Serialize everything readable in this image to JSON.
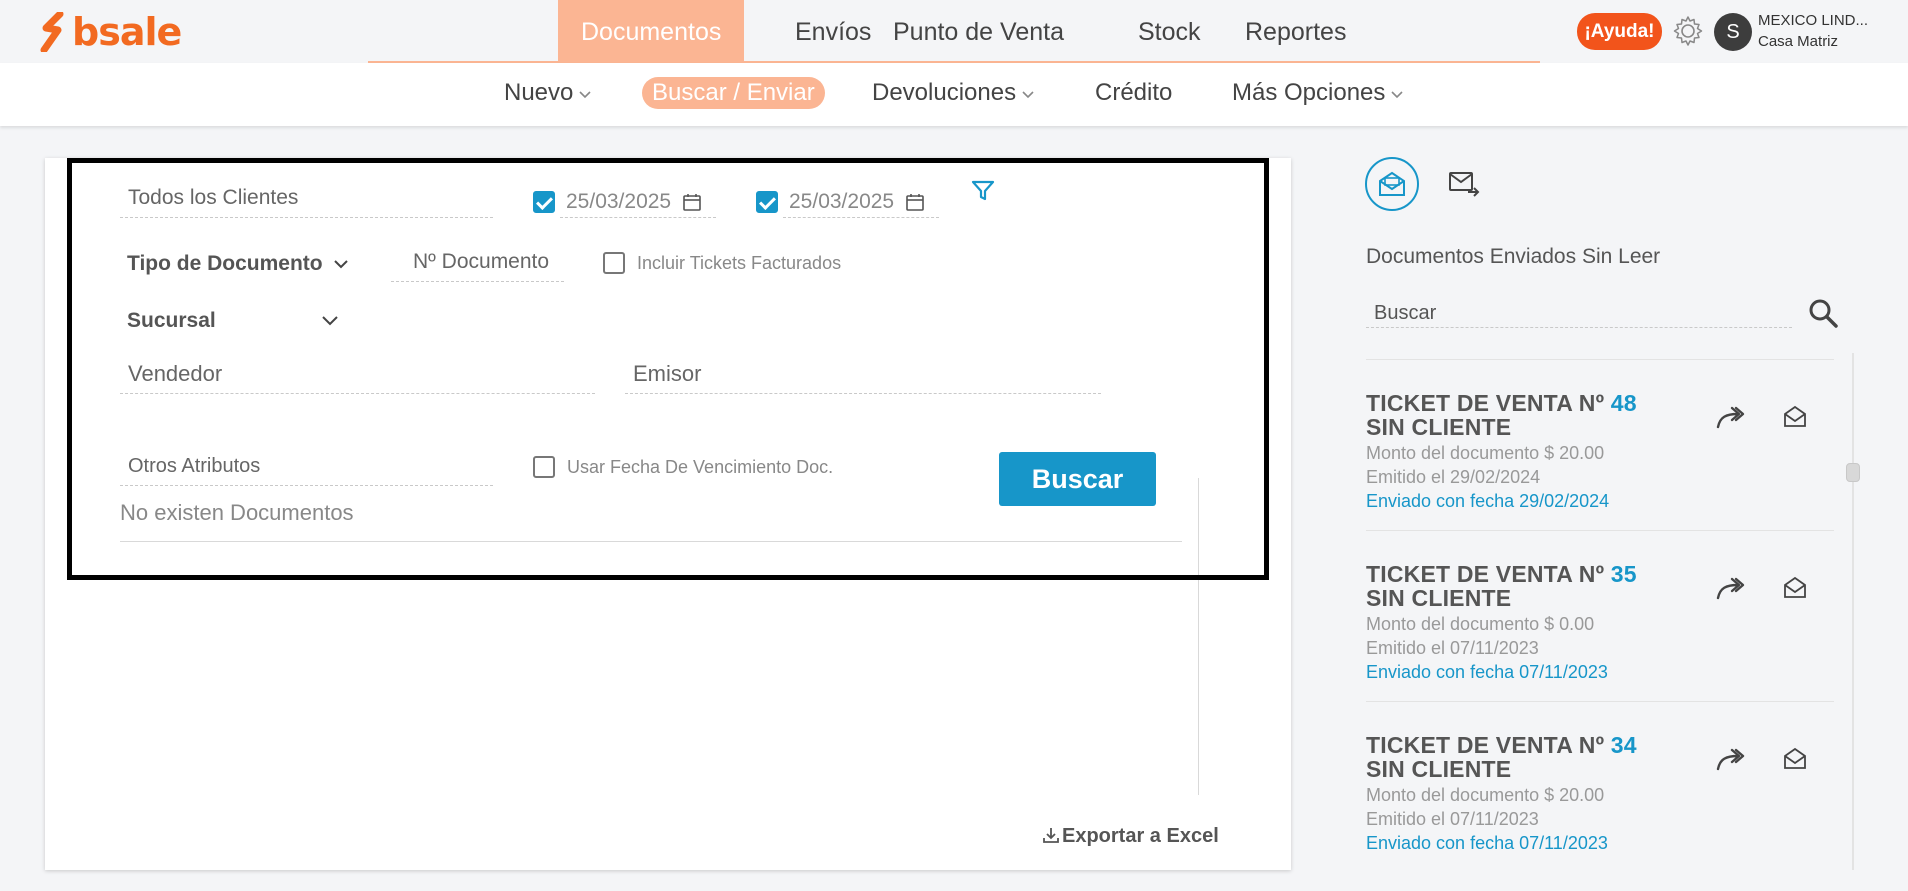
{
  "app": {
    "logo_text": "bsale",
    "brand_color": "#f26a21",
    "accent_color": "#1796c9",
    "nav_active_color": "#fbb593"
  },
  "main_nav": {
    "items": [
      {
        "label": "Documentos",
        "active": true
      },
      {
        "label": "Envíos",
        "active": false
      },
      {
        "label": "Punto de Venta",
        "active": false
      },
      {
        "label": "Stock",
        "active": false
      },
      {
        "label": "Reportes",
        "active": false
      }
    ]
  },
  "header": {
    "help_label": "¡Ayuda!",
    "avatar_initial": "S",
    "company_name": "MEXICO LIND...",
    "branch_name": "Casa Matriz"
  },
  "sub_nav": {
    "items": [
      {
        "label": "Nuevo",
        "dropdown": true,
        "active": false
      },
      {
        "label": "Buscar / Enviar",
        "dropdown": false,
        "active": true
      },
      {
        "label": "Devoluciones",
        "dropdown": true,
        "active": false
      },
      {
        "label": "Crédito",
        "dropdown": false,
        "active": false
      },
      {
        "label": "Más Opciones",
        "dropdown": true,
        "active": false
      }
    ]
  },
  "filters": {
    "clients_placeholder": "Todos los Clientes",
    "date_from": {
      "checked": true,
      "value": "25/03/2025"
    },
    "date_to": {
      "checked": true,
      "value": "25/03/2025"
    },
    "doc_type_label": "Tipo de Documento",
    "doc_number_placeholder": "Nº Documento",
    "include_tickets_label": "Incluir Tickets Facturados",
    "include_tickets_checked": false,
    "branch_label": "Sucursal",
    "seller_placeholder": "Vendedor",
    "issuer_placeholder": "Emisor",
    "other_attrs_placeholder": "Otros Atributos",
    "use_due_date_label": "Usar Fecha De Vencimiento Doc.",
    "use_due_date_checked": false,
    "search_button": "Buscar"
  },
  "results": {
    "empty_message": "No existen Documentos",
    "export_label": "Exportar a Excel"
  },
  "right_panel": {
    "title": "Documentos Enviados Sin Leer",
    "search_placeholder": "Buscar",
    "tickets": [
      {
        "title": "TICKET DE VENTA Nº",
        "number": "48",
        "client": "SIN CLIENTE",
        "amount": "Monto del documento $ 20.00",
        "issued": "Emitido el 29/02/2024",
        "sent": "Enviado con fecha 29/02/2024"
      },
      {
        "title": "TICKET DE VENTA Nº",
        "number": "35",
        "client": "SIN CLIENTE",
        "amount": "Monto del documento $ 0.00",
        "issued": "Emitido el 07/11/2023",
        "sent": "Enviado con fecha 07/11/2023"
      },
      {
        "title": "TICKET DE VENTA Nº",
        "number": "34",
        "client": "SIN CLIENTE",
        "amount": "Monto del documento $ 20.00",
        "issued": "Emitido el 07/11/2023",
        "sent": "Enviado con fecha 07/11/2023"
      }
    ]
  }
}
